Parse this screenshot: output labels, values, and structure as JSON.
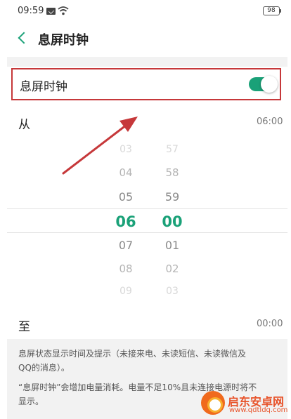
{
  "status_bar": {
    "time": "09:59",
    "battery": "98"
  },
  "header": {
    "title": "息屏时钟"
  },
  "setting": {
    "label": "息屏时钟",
    "enabled": true
  },
  "from": {
    "label": "从",
    "value": "06:00"
  },
  "to": {
    "label": "至",
    "value": "00:00"
  },
  "picker": {
    "hours": [
      "03",
      "04",
      "05",
      "06",
      "07",
      "08",
      "09"
    ],
    "minutes": [
      "57",
      "58",
      "59",
      "00",
      "01",
      "02",
      "03"
    ],
    "selected_index": 3
  },
  "footer": {
    "line1": "息屏状态显示时间及提示（未接来电、未读短信、未读微信及",
    "line2": "QQ的消息）。",
    "line3": "“息屏时钟”会增加电量消耗。电量不足10%且未连接电源时将不",
    "line4": "显示。"
  },
  "watermark": {
    "name": "启东安卓网",
    "url": "www.qdtldq.com"
  },
  "colors": {
    "accent": "#1aa178",
    "highlight": "#c6383a"
  }
}
